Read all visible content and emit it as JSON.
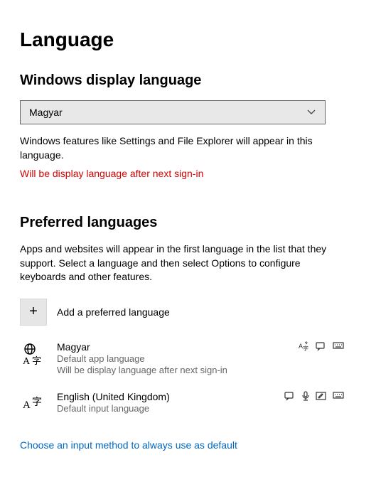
{
  "page_title": "Language",
  "display": {
    "heading": "Windows display language",
    "selected": "Magyar",
    "description": "Windows features like Settings and File Explorer will appear in this language.",
    "notice": "Will be display language after next sign-in"
  },
  "preferred": {
    "heading": "Preferred languages",
    "description": "Apps and websites will appear in the first language in the list that they support. Select a language and then select Options to configure keyboards and other features.",
    "add_label": "Add a preferred language",
    "items": [
      {
        "name": "Magyar",
        "sub1": "Default app language",
        "sub2": "Will be display language after next sign-in",
        "has_globe": true,
        "badges": [
          "display-pack",
          "tts",
          "keyboard"
        ]
      },
      {
        "name": "English (United Kingdom)",
        "sub1": "Default input language",
        "sub2": "",
        "has_globe": false,
        "badges": [
          "tts",
          "speech",
          "handwriting",
          "keyboard"
        ]
      }
    ]
  },
  "footer_link": "Choose an input method to always use as default"
}
